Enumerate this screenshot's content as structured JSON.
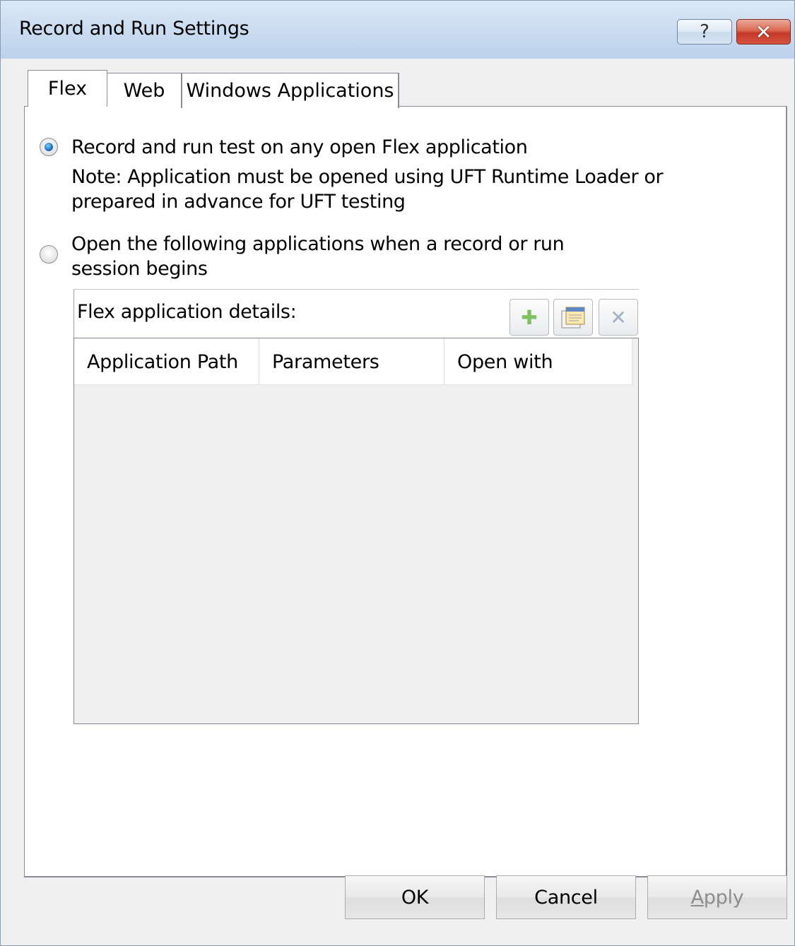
{
  "window": {
    "title": "Record and Run Settings",
    "help_glyph": "?",
    "close_glyph": "✕"
  },
  "tabs": [
    {
      "label": "Flex",
      "selected": true
    },
    {
      "label": "Web",
      "selected": false
    },
    {
      "label": "Windows Applications",
      "selected": false
    }
  ],
  "flex": {
    "option_any": {
      "label": "Record and run test on any open Flex application",
      "checked": true
    },
    "note": "Note: Application must be opened using UFT Runtime Loader or prepared in advance for UFT testing",
    "option_open": {
      "label": "Open the following applications when a record or run session begins",
      "checked": false
    },
    "details": {
      "title": "Flex application details:",
      "toolbar": {
        "add_icon": "add-icon",
        "properties_icon": "properties-icon",
        "delete_icon": "delete-icon"
      },
      "columns": [
        "Application Path",
        "Parameters",
        "Open with"
      ],
      "rows": []
    }
  },
  "footer": {
    "ok": "OK",
    "cancel": "Cancel",
    "apply_first": "A",
    "apply_rest": "pply"
  }
}
